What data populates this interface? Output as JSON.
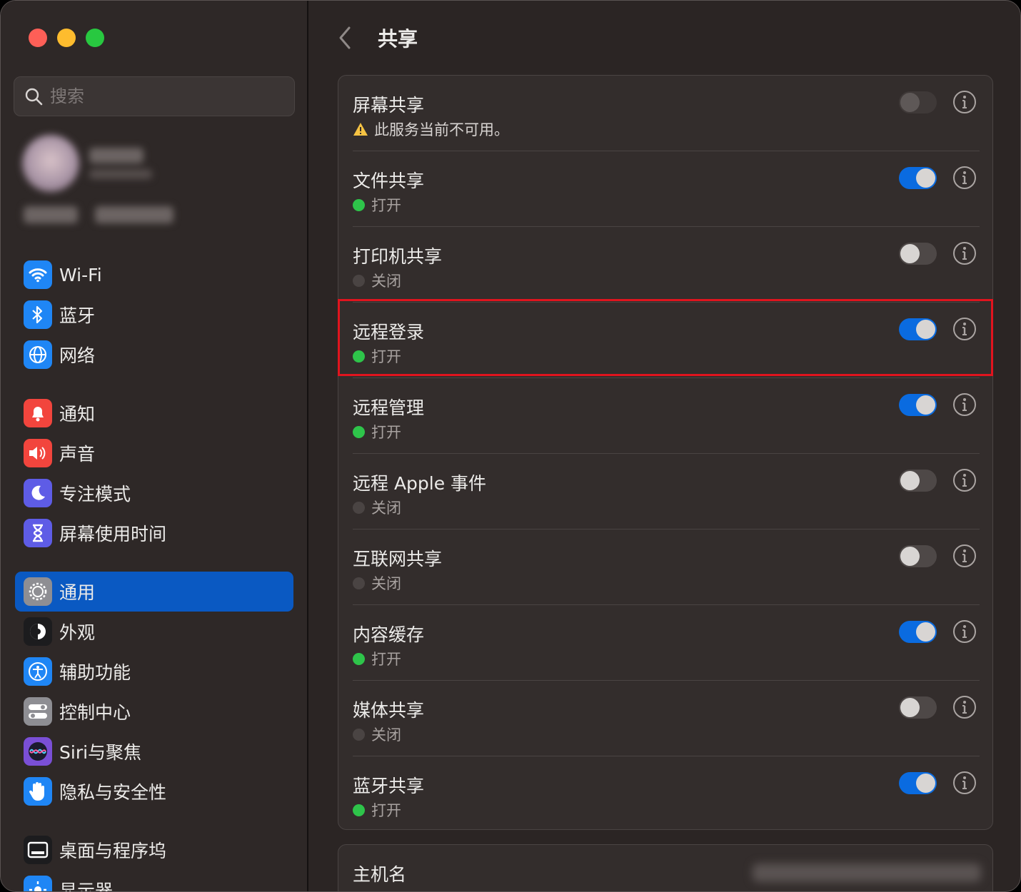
{
  "window": {
    "title": "共享"
  },
  "search": {
    "placeholder": "搜索"
  },
  "sidebar": {
    "items": [
      {
        "label": "Wi-Fi",
        "icon": "wifi-icon",
        "color": "#1f86f5"
      },
      {
        "label": "蓝牙",
        "icon": "bluetooth-icon",
        "color": "#1f86f5"
      },
      {
        "label": "网络",
        "icon": "globe-icon",
        "color": "#1f86f5"
      },
      {
        "label": "通知",
        "icon": "bell-icon",
        "color": "#f2453d"
      },
      {
        "label": "声音",
        "icon": "speaker-icon",
        "color": "#f2453d"
      },
      {
        "label": "专注模式",
        "icon": "moon-icon",
        "color": "#5e5ce6"
      },
      {
        "label": "屏幕使用时间",
        "icon": "hourglass-icon",
        "color": "#5e5ce6"
      },
      {
        "label": "通用",
        "icon": "gear-icon",
        "color": "#8e8e93",
        "selected": true
      },
      {
        "label": "外观",
        "icon": "appearance-icon",
        "color": "#1c1c1e"
      },
      {
        "label": "辅助功能",
        "icon": "accessibility-icon",
        "color": "#1f86f5"
      },
      {
        "label": "控制中心",
        "icon": "control-center-icon",
        "color": "#8e8e93"
      },
      {
        "label": "Siri与聚焦",
        "icon": "siri-icon",
        "color": "#7a4fd6"
      },
      {
        "label": "隐私与安全性",
        "icon": "hand-icon",
        "color": "#1f86f5"
      },
      {
        "label": "桌面与程序坞",
        "icon": "dock-icon",
        "color": "#1c1c1e"
      },
      {
        "label": "显示器",
        "icon": "display-icon",
        "color": "#1f86f5"
      }
    ]
  },
  "services": [
    {
      "title": "屏幕共享",
      "status": "此服务当前不可用。",
      "state": "warning",
      "toggle": "disabled"
    },
    {
      "title": "文件共享",
      "status": "打开",
      "state": "on",
      "toggle": "on"
    },
    {
      "title": "打印机共享",
      "status": "关闭",
      "state": "off",
      "toggle": "off"
    },
    {
      "title": "远程登录",
      "status": "打开",
      "state": "on",
      "toggle": "on",
      "highlighted": true
    },
    {
      "title": "远程管理",
      "status": "打开",
      "state": "on",
      "toggle": "on"
    },
    {
      "title": "远程 Apple 事件",
      "status": "关闭",
      "state": "off",
      "toggle": "off"
    },
    {
      "title": "互联网共享",
      "status": "关闭",
      "state": "off",
      "toggle": "off"
    },
    {
      "title": "内容缓存",
      "status": "打开",
      "state": "on",
      "toggle": "on"
    },
    {
      "title": "媒体共享",
      "status": "关闭",
      "state": "off",
      "toggle": "off"
    },
    {
      "title": "蓝牙共享",
      "status": "打开",
      "state": "on",
      "toggle": "on"
    }
  ],
  "hostname": {
    "label": "主机名"
  },
  "colors": {
    "accent": "#0a6be0",
    "selected_bg": "#0a59c2",
    "highlight": "#e0141e",
    "status_on": "#2ec44a"
  }
}
